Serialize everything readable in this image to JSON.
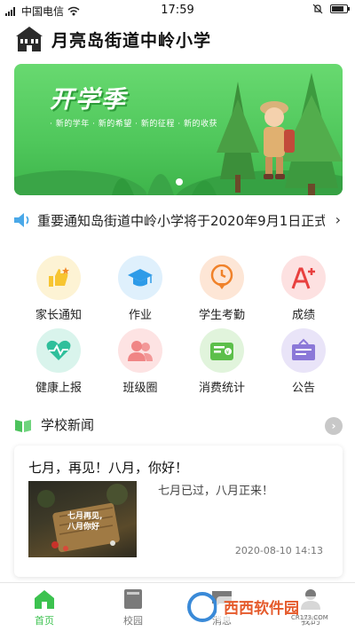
{
  "status_bar": {
    "carrier": "中国电信",
    "time": "17:59",
    "battery_level": 0.8
  },
  "header": {
    "school_name": "月亮岛街道中岭小学"
  },
  "banner": {
    "title": "开学季",
    "subtitle": "· 新的学年 · 新的希望 · 新的征程 · 新的收获",
    "slide_count": 1,
    "active_slide": 1
  },
  "notice": {
    "text": "重要通知岛街道中岭小学将于2020年9月1日正式"
  },
  "grid": {
    "items": [
      {
        "label": "家长通知",
        "icon": "thumbs-up-icon",
        "color": "#f7c531",
        "bg": "#fdf3d4"
      },
      {
        "label": "作业",
        "icon": "graduation-cap-icon",
        "color": "#2e9be8",
        "bg": "#dff0fc"
      },
      {
        "label": "学生考勤",
        "icon": "location-pin-icon",
        "color": "#f0822a",
        "bg": "#fde6d6"
      },
      {
        "label": "成绩",
        "icon": "a-plus-icon",
        "color": "#e8403f",
        "bg": "#fde1e1"
      },
      {
        "label": "健康上报",
        "icon": "heart-pulse-icon",
        "color": "#2fbf9b",
        "bg": "#d9f4ec"
      },
      {
        "label": "班级圈",
        "icon": "users-icon",
        "color": "#f08585",
        "bg": "#fde3e3"
      },
      {
        "label": "消费统计",
        "icon": "wallet-icon",
        "color": "#5cbf4a",
        "bg": "#e1f4dc"
      },
      {
        "label": "公告",
        "icon": "notice-board-icon",
        "color": "#8b78d8",
        "bg": "#e9e4f8"
      }
    ]
  },
  "news": {
    "section_title": "学校新闻",
    "more_label": "›",
    "card": {
      "title": "七月，再见！八月，你好！",
      "summary": "七月已过，八月正来！",
      "thumb_text_line1": "七月再见,",
      "thumb_text_line2": "八月你好",
      "date": "2020-08-10 14:13"
    }
  },
  "bottom_nav": {
    "items": [
      {
        "label": "首页",
        "icon": "home-icon",
        "active": true
      },
      {
        "label": "校园",
        "icon": "book-icon",
        "active": false
      },
      {
        "label": "消息",
        "icon": "message-icon",
        "active": false
      },
      {
        "label": "我的",
        "icon": "profile-icon",
        "active": false
      }
    ]
  },
  "watermark": {
    "text": "西西软件园",
    "url": "CR173.COM"
  },
  "colors": {
    "accent": "#3cc24f",
    "banner_green": "#4fc75b"
  }
}
